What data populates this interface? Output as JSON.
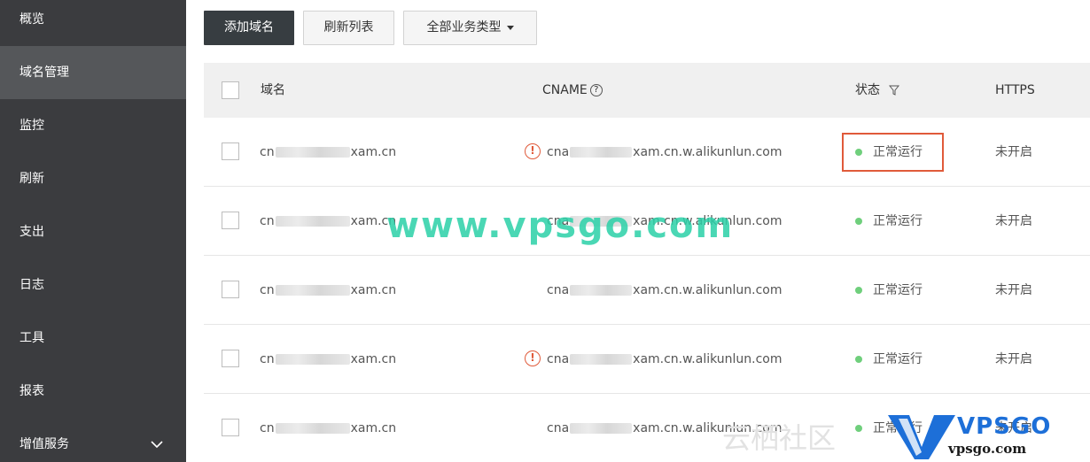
{
  "sidebar": {
    "items": [
      {
        "label": "概览"
      },
      {
        "label": "域名管理"
      },
      {
        "label": "监控"
      },
      {
        "label": "刷新"
      },
      {
        "label": "支出"
      },
      {
        "label": "日志"
      },
      {
        "label": "工具"
      },
      {
        "label": "报表"
      },
      {
        "label": "增值服务"
      }
    ]
  },
  "toolbar": {
    "add_label": "添加域名",
    "refresh_label": "刷新列表",
    "type_filter_label": "全部业务类型"
  },
  "table": {
    "headers": {
      "domain": "域名",
      "cname": "CNAME",
      "status": "状态",
      "https": "HTTPS"
    },
    "rows": [
      {
        "domain_prefix": "cn",
        "domain_suffix": "xam.cn",
        "cname_prefix": "cna",
        "cname_suffix": "xam.cn.w.alikunlun.com",
        "warning": true,
        "status": "正常运行",
        "https": "未开启"
      },
      {
        "domain_prefix": "cn",
        "domain_suffix": "xam.cn",
        "cname_prefix": "cna",
        "cname_suffix": "xam.cn.w.alikunlun.com",
        "warning": false,
        "status": "正常运行",
        "https": "未开启"
      },
      {
        "domain_prefix": "cn",
        "domain_suffix": "xam.cn",
        "cname_prefix": "cna",
        "cname_suffix": "xam.cn.w.alikunlun.com",
        "warning": false,
        "status": "正常运行",
        "https": "未开启"
      },
      {
        "domain_prefix": "cn",
        "domain_suffix": "xam.cn",
        "cname_prefix": "cna",
        "cname_suffix": "xam.cn.w.alikunlun.com",
        "warning": true,
        "status": "正常运行",
        "https": "未开启"
      },
      {
        "domain_prefix": "cn",
        "domain_suffix": "xam.cn",
        "cname_prefix": "cna",
        "cname_suffix": "xam.cn.w.alikunlun.com",
        "warning": false,
        "status": "正常运行",
        "https": "未开启"
      }
    ]
  },
  "watermark": {
    "main": "www.vpsgo.com",
    "cn": "云栖社区",
    "logo_top": "VPSGO",
    "logo_bottom": "vpsgo.com"
  },
  "colors": {
    "sidebar_bg": "#3b3c3f",
    "status_ok": "#6fcf7c",
    "warning": "#e05a3a",
    "watermark": "#2bd1a8"
  }
}
